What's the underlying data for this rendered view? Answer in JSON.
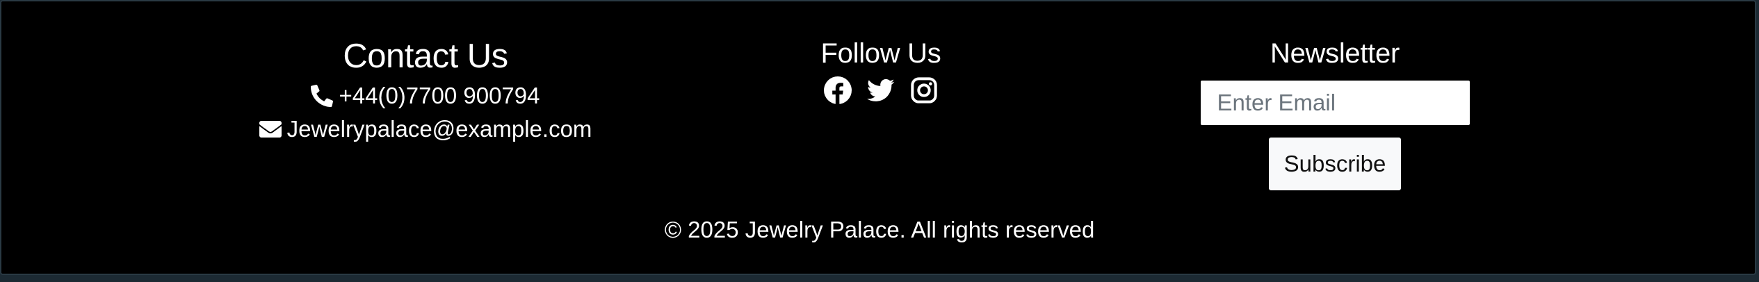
{
  "contact": {
    "heading": "Contact Us",
    "phone": "+44(0)7700 900794",
    "email": "Jewelrypalace@example.com",
    "phone_icon": "phone-icon",
    "email_icon": "envelope-icon"
  },
  "follow": {
    "heading": "Follow Us",
    "icons": [
      "facebook-icon",
      "twitter-icon",
      "instagram-icon"
    ]
  },
  "newsletter": {
    "heading": "Newsletter",
    "email_placeholder": "Enter Email",
    "email_value": "",
    "subscribe_label": "Subscribe"
  },
  "copyright": "© 2025 Jewelry Palace. All rights reserved",
  "colors": {
    "footer_background": "#000000",
    "text": "#ffffff",
    "button_background": "#f8f9fa"
  }
}
